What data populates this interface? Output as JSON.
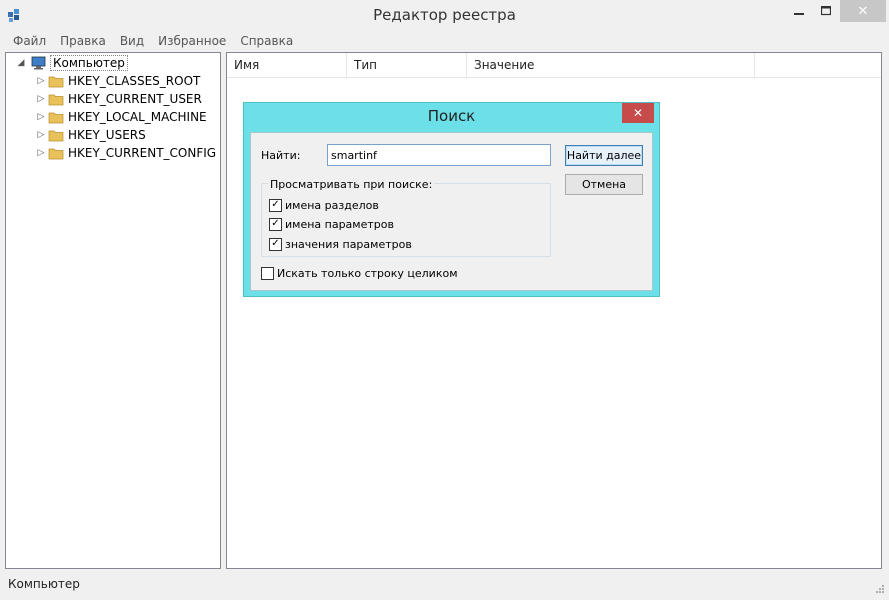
{
  "window": {
    "title": "Редактор реестра"
  },
  "menu": [
    "Файл",
    "Правка",
    "Вид",
    "Избранное",
    "Справка"
  ],
  "tree": {
    "root": "Компьютер",
    "keys": [
      "HKEY_CLASSES_ROOT",
      "HKEY_CURRENT_USER",
      "HKEY_LOCAL_MACHINE",
      "HKEY_USERS",
      "HKEY_CURRENT_CONFIG"
    ]
  },
  "list": {
    "columns": [
      "Имя",
      "Тип",
      "Значение"
    ]
  },
  "status": {
    "path": "Компьютер"
  },
  "dialog": {
    "title": "Поиск",
    "find_label": "Найти:",
    "find_value": "smartinf",
    "find_next": "Найти далее",
    "cancel": "Отмена",
    "look_at_label": "Просматривать при поиске:",
    "options": [
      {
        "label": "имена разделов",
        "checked": true
      },
      {
        "label": "имена параметров",
        "checked": true
      },
      {
        "label": "значения параметров",
        "checked": true
      }
    ],
    "whole_string": {
      "label": "Искать только строку целиком",
      "checked": false
    }
  },
  "colors": {
    "dialog_frame": "#6ce0e9",
    "close_red": "#c74b4b",
    "folder": "#e8c15a"
  }
}
